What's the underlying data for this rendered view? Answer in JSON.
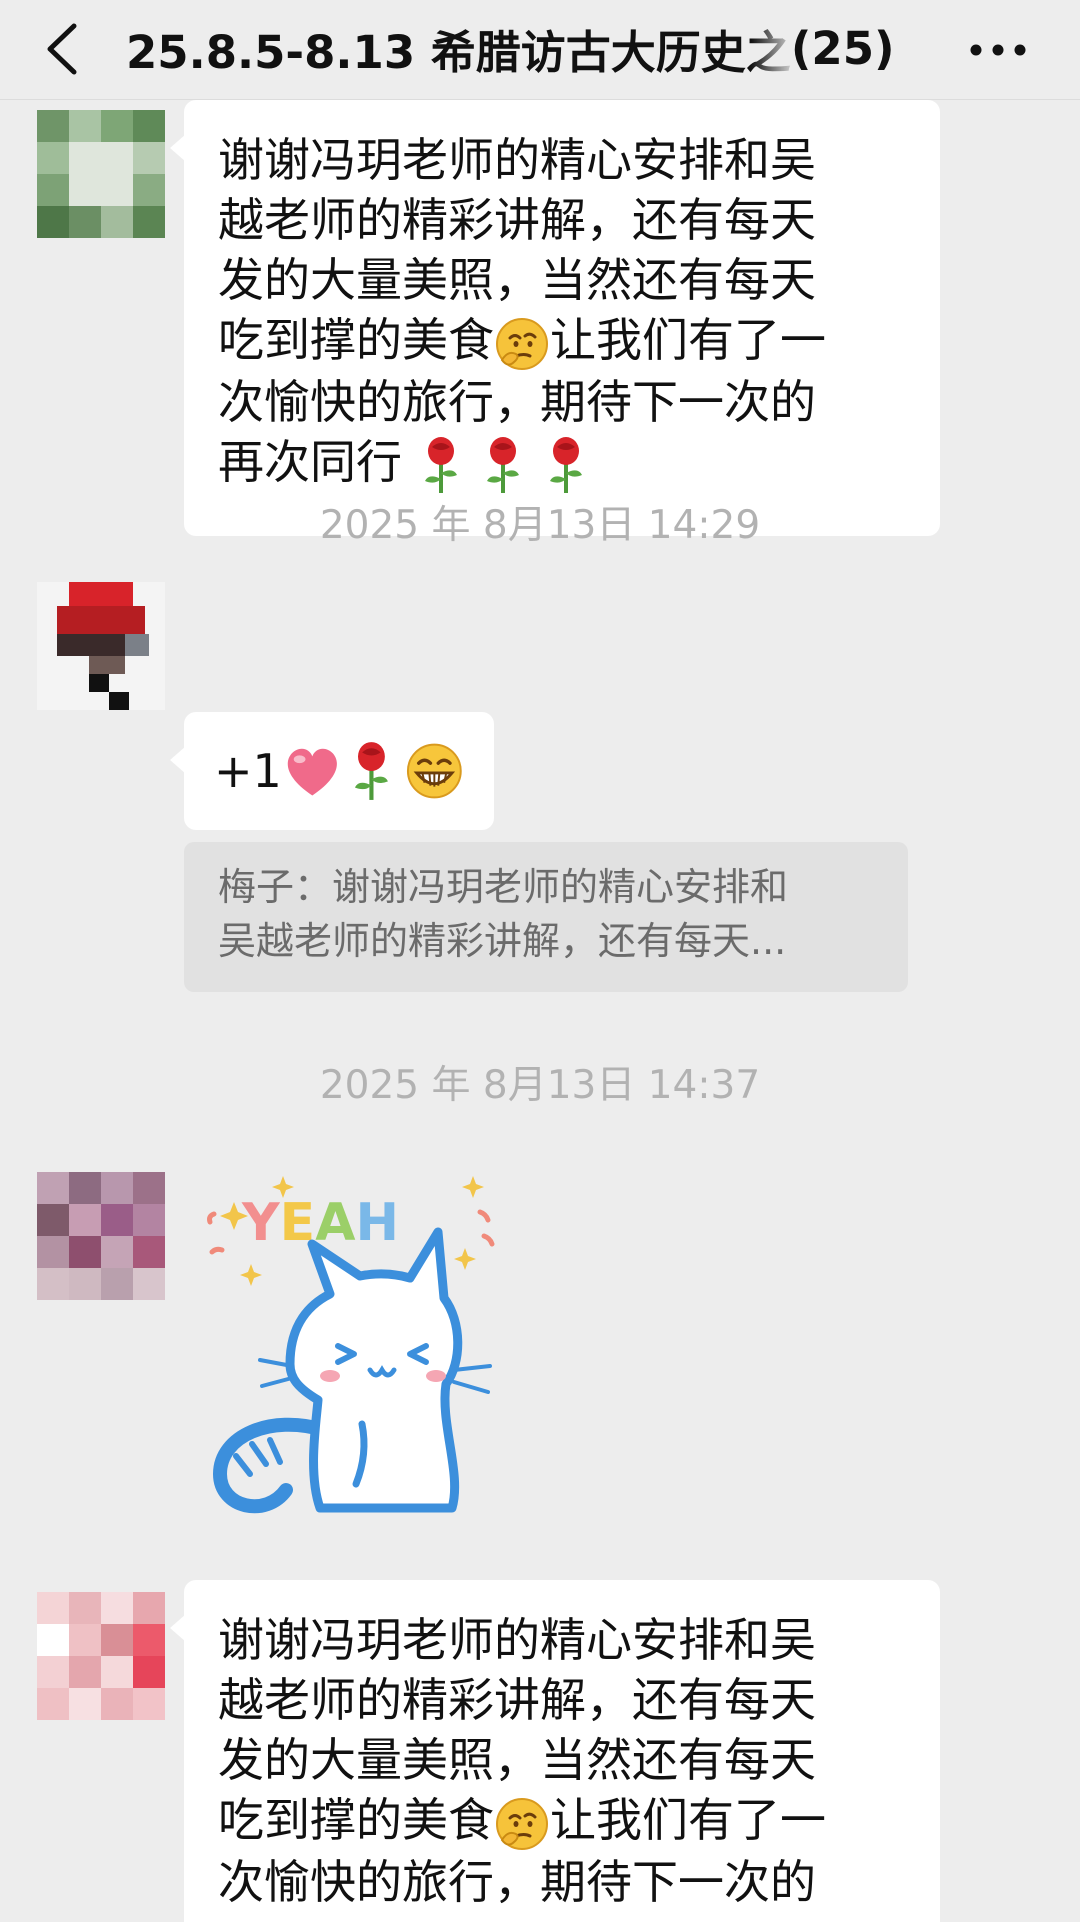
{
  "header": {
    "title": "25.8.5-8.13 希腊访古大历史之",
    "member_count": "(25)",
    "back_icon": "chevron-left-icon",
    "more_icon": "more-dots-icon"
  },
  "messages": [
    {
      "type": "text",
      "lines": [
        "谢谢冯玥老师的精心安排和吴",
        "越老师的精彩讲解，还有每天",
        "发的大量美照，当然还有每天",
        "吃到撑的美食",
        "让我们有了一",
        "次愉快的旅行，期待下一次的",
        "再次同行"
      ],
      "emojis": [
        "thinking-face-emoji",
        "rose-emoji",
        "rose-emoji",
        "rose-emoji"
      ]
    },
    {
      "type": "timestamp",
      "text": "2025 年 8月13日 14:29"
    },
    {
      "type": "text",
      "text": "+1",
      "emojis": [
        "heart-emoji",
        "rose-emoji",
        "grinning-face-emoji"
      ],
      "quote": {
        "lines": [
          "梅子：谢谢冯玥老师的精心安排和",
          "吴越老师的精彩讲解，还有每天..."
        ]
      }
    },
    {
      "type": "timestamp",
      "text": "2025 年 8月13日 14:37"
    },
    {
      "type": "sticker",
      "sticker_text": "YEAH",
      "sticker_name": "yeah-cat-sticker"
    },
    {
      "type": "text",
      "lines": [
        "谢谢冯玥老师的精心安排和吴",
        "越老师的精彩讲解，还有每天",
        "发的大量美照，当然还有每天",
        "吃到撑的美食",
        "让我们有了一",
        "次愉快的旅行，期待下一次的"
      ],
      "emojis": [
        "thinking-face-emoji"
      ]
    }
  ],
  "colors": {
    "background": "#ededed",
    "bubble": "#ffffff",
    "quote_bg": "#e1e1e1",
    "timestamp": "#b2b2b2",
    "sticker_blue": "#3c8fdc"
  }
}
